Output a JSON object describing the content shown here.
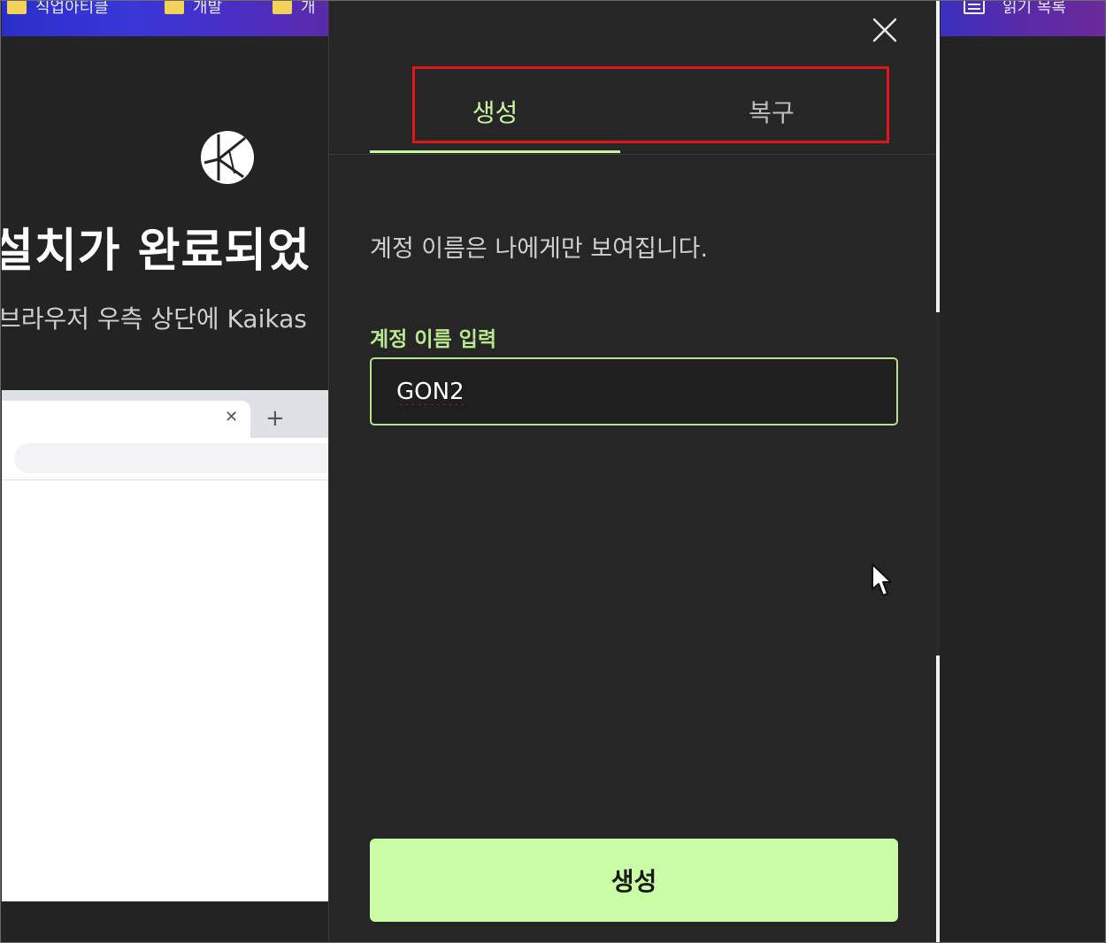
{
  "bookmarks_bar": {
    "items": [
      {
        "label": "직업아티클",
        "icon": "folder-icon"
      },
      {
        "label": "개발",
        "icon": "folder-icon"
      },
      {
        "label": "개",
        "icon": "folder-icon"
      }
    ],
    "reading_list": {
      "label": "읽기 목록",
      "icon": "reading-list-icon"
    }
  },
  "background_page": {
    "logo": "kaikas-logo",
    "title": "설치가 완료되었",
    "subtitle": "브라우저 우측 상단에 Kaikas"
  },
  "panel": {
    "close_icon": "close-icon",
    "tabs": [
      {
        "label": "생성",
        "active": true
      },
      {
        "label": "복구",
        "active": false
      }
    ],
    "info_text": "계정 이름은 나에게만 보여집니다.",
    "field_label": "계정 이름 입력",
    "account_name_value": "GON2",
    "create_button_label": "생성"
  },
  "colors": {
    "accent": "#c8f59f",
    "button_bg": "#cbfca6",
    "panel_bg": "#262626",
    "annotation": "#e0161c"
  }
}
